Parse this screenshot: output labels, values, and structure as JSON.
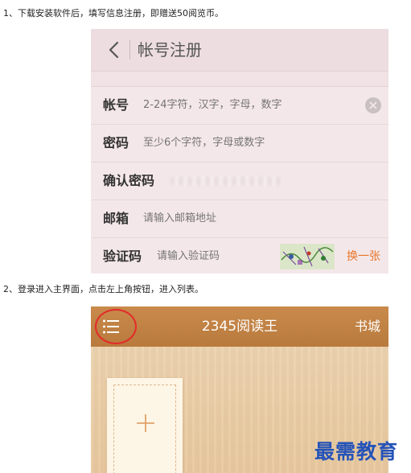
{
  "instructions": {
    "step1": "1、下载安装软件后，填写信息注册，即赠送50阅览币。",
    "step2": "2、登录进入主界面，点击左上角按钮，进入列表。"
  },
  "register_screen": {
    "title": "帐号注册",
    "fields": {
      "account": {
        "label": "帐号",
        "placeholder": "2-24字符，汉字，字母，数字"
      },
      "password": {
        "label": "密码",
        "placeholder": "至少6个字符，字母或数字"
      },
      "confirm_password": {
        "label": "确认密码"
      },
      "email": {
        "label": "邮箱",
        "placeholder": "请输入邮箱地址"
      },
      "captcha": {
        "label": "验证码",
        "placeholder": "请输入验证码",
        "refresh_label": "换一张"
      }
    },
    "colors": {
      "accent": "#e8762a",
      "background": "#f3e6e8"
    }
  },
  "home_screen": {
    "title": "2345阅读王",
    "bookstore_label": "书城",
    "add_symbol": "+",
    "colors": {
      "top_bar": "#c08244",
      "highlight": "#e32a2a"
    }
  },
  "watermark": "最需教育"
}
